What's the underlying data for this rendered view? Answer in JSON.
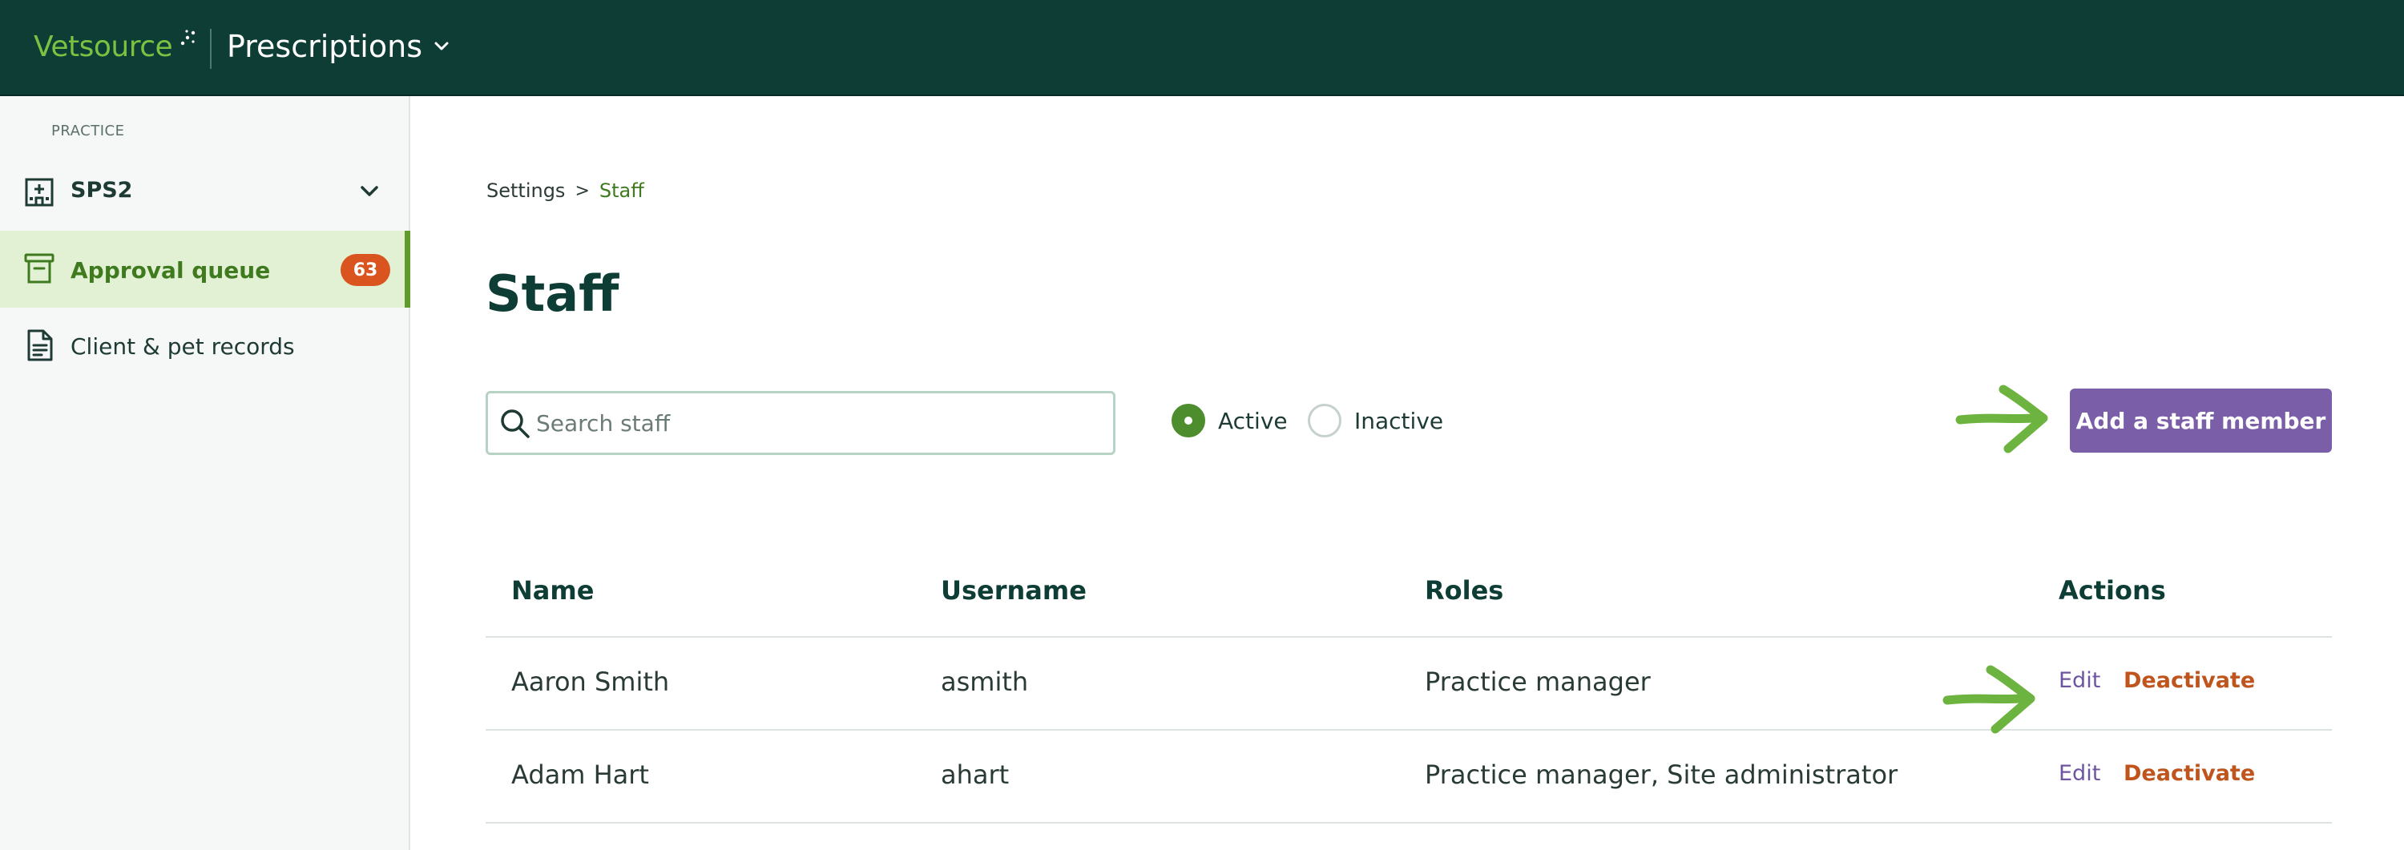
{
  "header": {
    "brand": "Vetsource",
    "app_name": "Prescriptions"
  },
  "sidebar": {
    "section_label": "PRACTICE",
    "practice_name": "SPS2",
    "items": [
      {
        "label": "Approval queue",
        "badge": "63",
        "active": true,
        "icon": "inbox-tray-icon"
      },
      {
        "label": "Client & pet records",
        "active": false,
        "icon": "document-icon"
      }
    ]
  },
  "breadcrumb": {
    "parent": "Settings",
    "separator": ">",
    "current": "Staff"
  },
  "page": {
    "title": "Staff"
  },
  "filters": {
    "search_placeholder": "Search staff",
    "search_value": "",
    "status_options": [
      {
        "label": "Active",
        "selected": true
      },
      {
        "label": "Inactive",
        "selected": false
      }
    ]
  },
  "actions": {
    "add_label": "Add a staff member"
  },
  "table": {
    "columns": [
      "Name",
      "Username",
      "Roles",
      "Actions"
    ],
    "rows": [
      {
        "name": "Aaron Smith",
        "username": "asmith",
        "roles": "Practice manager",
        "edit": "Edit",
        "deactivate": "Deactivate"
      },
      {
        "name": "Adam Hart",
        "username": "ahart",
        "roles": "Practice manager, Site administrator",
        "edit": "Edit",
        "deactivate": "Deactivate"
      }
    ]
  },
  "colors": {
    "header_bg": "#0d3d34",
    "brand_green": "#7cc242",
    "primary_button": "#7a5fa8",
    "deactivate": "#c0541d",
    "badge": "#d9541e",
    "annotation_arrow": "#6db33f"
  }
}
